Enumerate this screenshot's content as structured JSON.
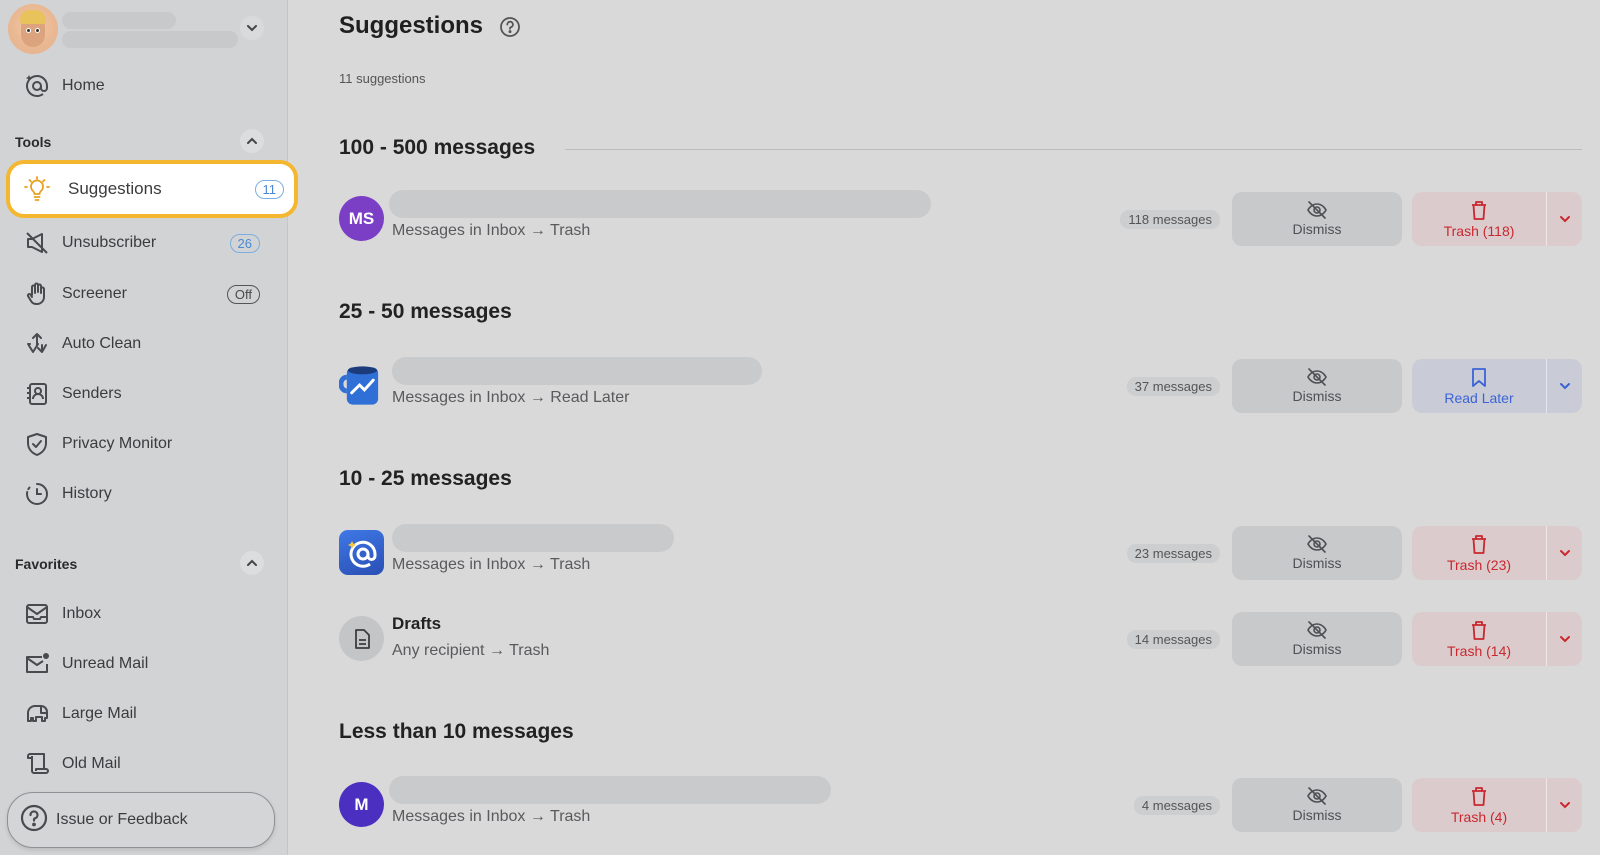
{
  "sidebar": {
    "account": {
      "avatar": "memoji-avatar",
      "name_redacted": true,
      "email_redacted": true
    },
    "home": {
      "label": "Home",
      "icon": "at-sparkle-icon"
    },
    "tools_section": {
      "title": "Tools",
      "collapsed": false
    },
    "tools": [
      {
        "label": "Suggestions",
        "icon": "lightbulb-icon",
        "badge": "11",
        "badge_style": "blue",
        "active": true
      },
      {
        "label": "Unsubscriber",
        "icon": "megaphone-off-icon",
        "badge": "26",
        "badge_style": "blue"
      },
      {
        "label": "Screener",
        "icon": "hand-icon",
        "badge": "Off",
        "badge_style": "gray"
      },
      {
        "label": "Auto Clean",
        "icon": "arrows-icon"
      },
      {
        "label": "Senders",
        "icon": "contacts-book-icon"
      },
      {
        "label": "Privacy Monitor",
        "icon": "shield-check-icon"
      },
      {
        "label": "History",
        "icon": "clock-icon"
      }
    ],
    "favorites_section": {
      "title": "Favorites",
      "collapsed": false
    },
    "favorites": [
      {
        "label": "Inbox",
        "icon": "inbox-icon"
      },
      {
        "label": "Unread Mail",
        "icon": "unread-mail-icon"
      },
      {
        "label": "Large Mail",
        "icon": "elephant-icon"
      },
      {
        "label": "Old Mail",
        "icon": "scroll-icon"
      }
    ],
    "feedback": {
      "label": "Issue or Feedback",
      "icon": "question-circle-icon"
    }
  },
  "main": {
    "title": "Suggestions",
    "count_text": "11 suggestions",
    "groups": [
      {
        "title": "100 - 500 messages",
        "items": [
          {
            "logo": "MS",
            "logo_color": "#7a3fc4",
            "rule": "Messages in Inbox → Trash",
            "count": "118 messages",
            "dismiss": "Dismiss",
            "action": "Trash (118)",
            "action_type": "trash"
          }
        ]
      },
      {
        "title": "25 - 50 messages",
        "items": [
          {
            "logo": "mug-chart-logo",
            "rule": "Messages in Inbox → Read Later",
            "count": "37 messages",
            "dismiss": "Dismiss",
            "action": "Read Later",
            "action_type": "later"
          }
        ]
      },
      {
        "title": "10 - 25 messages",
        "items": [
          {
            "logo": "at-app-logo",
            "rule": "Messages in Inbox → Trash",
            "count": "23 messages",
            "dismiss": "Dismiss",
            "action": "Trash (23)",
            "action_type": "trash"
          },
          {
            "logo": "document-icon",
            "name": "Drafts",
            "rule": "Any recipient → Trash",
            "count": "14 messages",
            "dismiss": "Dismiss",
            "action": "Trash (14)",
            "action_type": "trash"
          }
        ]
      },
      {
        "title": "Less than 10 messages",
        "items": [
          {
            "logo": "M",
            "logo_color": "#4b2fc0",
            "rule": "Messages in Inbox → Trash",
            "count": "4 messages",
            "dismiss": "Dismiss",
            "action": "Trash (4)",
            "action_type": "trash"
          }
        ]
      }
    ]
  },
  "colors": {
    "accent_highlight": "#f5b730",
    "trash": "#c8282e",
    "read_later": "#3b63d6",
    "badge_blue": "#4a89d6"
  }
}
